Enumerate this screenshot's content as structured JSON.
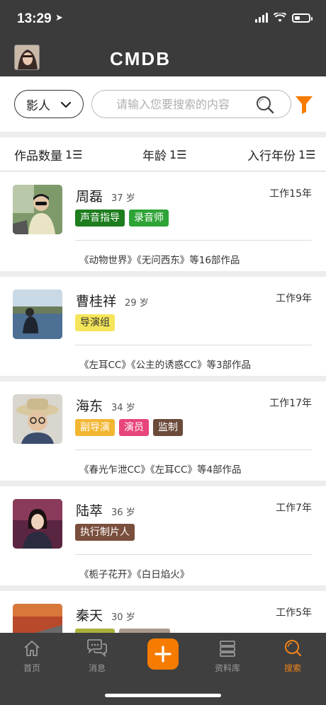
{
  "status_bar": {
    "time": "13:29"
  },
  "header": {
    "logo": "CMDB"
  },
  "search": {
    "filter_label": "影人",
    "placeholder": "请输入您要搜索的内容"
  },
  "sort": {
    "by_works": "作品数量",
    "by_age": "年龄",
    "by_year": "入行年份"
  },
  "people": [
    {
      "name": "周磊",
      "age": "37 岁",
      "years": "工作15年",
      "tags": [
        {
          "text": "声音指导",
          "color": "#1e7d1e"
        },
        {
          "text": "录音师",
          "color": "#2ea336"
        }
      ],
      "works": "《动物世界》《无问西东》等16部作品"
    },
    {
      "name": "曹桂祥",
      "age": "29 岁",
      "years": "工作9年",
      "tags": [
        {
          "text": "导演组",
          "color": "#f5e55a",
          "text_color": "#333333"
        }
      ],
      "works": "《左耳CC》《公主的诱惑CC》等3部作品"
    },
    {
      "name": "海东",
      "age": "34 岁",
      "years": "工作17年",
      "tags": [
        {
          "text": "副导演",
          "color": "#f2b632"
        },
        {
          "text": "演员",
          "color": "#e8457a"
        },
        {
          "text": "监制",
          "color": "#6b4a3a"
        }
      ],
      "works": "《春光乍泄CC》《左耳CC》等4部作品"
    },
    {
      "name": "陆萃",
      "age": "36 岁",
      "years": "工作7年",
      "tags": [
        {
          "text": "执行制片人",
          "color": "#7a4e3c"
        }
      ],
      "works": "《栀子花开》《白日焰火》"
    },
    {
      "name": "秦天",
      "age": "30 岁",
      "years": "工作5年",
      "tags": [
        {
          "text": "",
          "color": "#a8b23c"
        },
        {
          "text": "",
          "color": "#a99a8e"
        }
      ],
      "works": ""
    }
  ],
  "tabbar": {
    "home": "首页",
    "messages": "消息",
    "library": "资料库",
    "search": "搜索"
  }
}
